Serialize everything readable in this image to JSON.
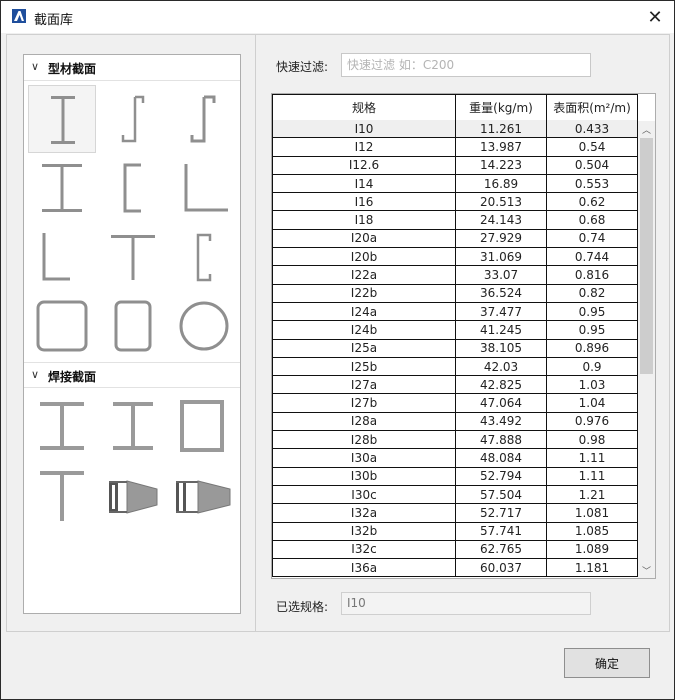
{
  "window": {
    "title": "截面库",
    "close_glyph": "✕",
    "app_icon": "revit-a-icon"
  },
  "left_panel": {
    "sections": [
      {
        "label": "型材截面",
        "chevron": "∨",
        "shapes": [
          "i-beam",
          "z-section",
          "z-section-alt",
          "wide-flange-i",
          "channel",
          "equal-angle",
          "unequal-angle",
          "t-section",
          "lipped-channel",
          "square-hollow",
          "rectangular-hollow",
          "circular-hollow"
        ],
        "selected_shape": "i-beam"
      },
      {
        "label": "焊接截面",
        "chevron": "∨",
        "shapes": [
          "welded-i",
          "welded-i-narrow",
          "welded-box",
          "welded-t",
          "tapered-i",
          "tapered-i-alt"
        ]
      }
    ]
  },
  "filter": {
    "label": "快速过滤:",
    "placeholder": "快速过滤 如：C200",
    "value": ""
  },
  "table": {
    "columns": [
      "规格",
      "重量(kg/m)",
      "表面积(m²/m)"
    ],
    "rows": [
      [
        "I10",
        "11.261",
        "0.433"
      ],
      [
        "I12",
        "13.987",
        "0.54"
      ],
      [
        "I12.6",
        "14.223",
        "0.504"
      ],
      [
        "I14",
        "16.89",
        "0.553"
      ],
      [
        "I16",
        "20.513",
        "0.62"
      ],
      [
        "I18",
        "24.143",
        "0.68"
      ],
      [
        "I20a",
        "27.929",
        "0.74"
      ],
      [
        "I20b",
        "31.069",
        "0.744"
      ],
      [
        "I22a",
        "33.07",
        "0.816"
      ],
      [
        "I22b",
        "36.524",
        "0.82"
      ],
      [
        "I24a",
        "37.477",
        "0.95"
      ],
      [
        "I24b",
        "41.245",
        "0.95"
      ],
      [
        "I25a",
        "38.105",
        "0.896"
      ],
      [
        "I25b",
        "42.03",
        "0.9"
      ],
      [
        "I27a",
        "42.825",
        "1.03"
      ],
      [
        "I27b",
        "47.064",
        "1.04"
      ],
      [
        "I28a",
        "43.492",
        "0.976"
      ],
      [
        "I28b",
        "47.888",
        "0.98"
      ],
      [
        "I30a",
        "48.084",
        "1.11"
      ],
      [
        "I30b",
        "52.794",
        "1.11"
      ],
      [
        "I30c",
        "57.504",
        "1.21"
      ],
      [
        "I32a",
        "52.717",
        "1.081"
      ],
      [
        "I32b",
        "57.741",
        "1.085"
      ],
      [
        "I32c",
        "62.765",
        "1.089"
      ],
      [
        "I36a",
        "60.037",
        "1.181"
      ]
    ],
    "selected_row": 0,
    "scroll_up": "︿",
    "scroll_down": "﹀"
  },
  "selected_spec": {
    "label": "已选规格:",
    "value": "I10"
  },
  "ok_button": {
    "label": "确定"
  }
}
